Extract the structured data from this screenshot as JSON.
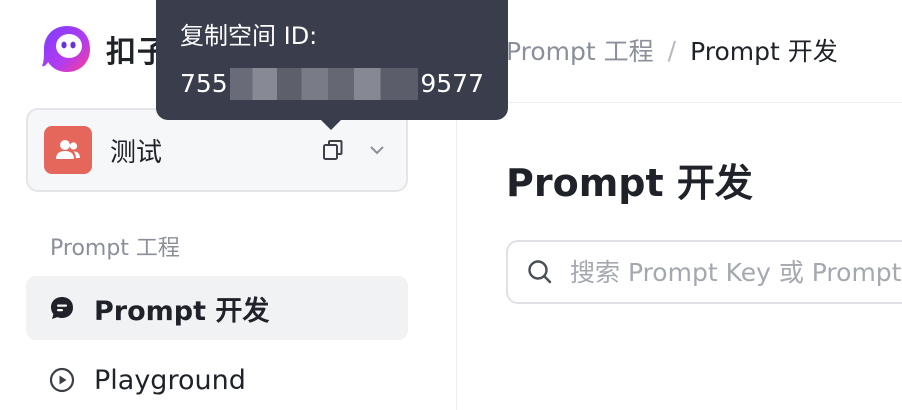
{
  "brand": {
    "name": "扣子"
  },
  "space": {
    "name": "测试",
    "avatar_color": "#e5665a",
    "tooltip_title": "复制空间 ID:",
    "id_prefix": "755",
    "id_suffix": "9577"
  },
  "sidebar": {
    "section_label": "Prompt 工程",
    "items": [
      {
        "label": "Prompt 开发",
        "icon": "chat-bubble-icon",
        "active": true
      },
      {
        "label": "Playground",
        "icon": "play-circle-icon",
        "active": false
      }
    ]
  },
  "breadcrumb": {
    "parent": "Prompt 工程",
    "separator": "/",
    "current": "Prompt 开发"
  },
  "main": {
    "title": "Prompt 开发",
    "search_placeholder": "搜索 Prompt Key 或 Prompt 名称"
  },
  "colors": {
    "tooltip_bg": "#3a3d4b",
    "active_item_bg": "#f1f2f4"
  }
}
